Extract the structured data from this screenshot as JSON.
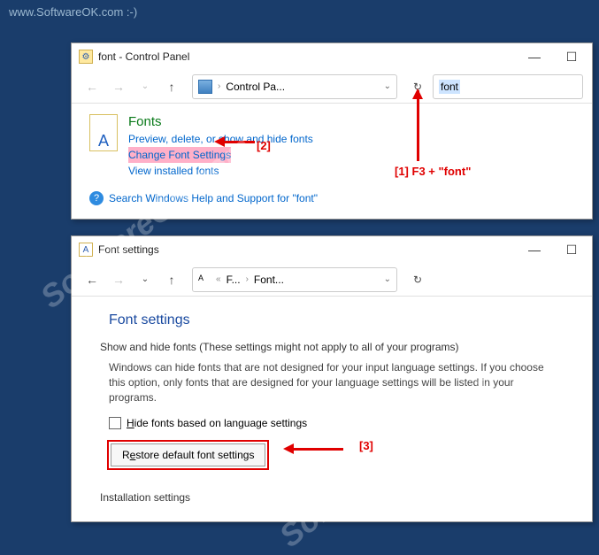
{
  "page": {
    "url_label": "www.SoftwareOK.com :-)",
    "watermark": "SoftwareOK.com"
  },
  "window1": {
    "title": "font - Control Panel",
    "address": "Control Pa...",
    "search_value": "font",
    "fonts_heading": "Fonts",
    "link_preview": "Preview, delete, or show and hide fonts",
    "link_change": "Change Font Settings",
    "link_view": "View installed fonts",
    "help_text": "Search Windows Help and Support for \"font\""
  },
  "window2": {
    "title": "Font settings",
    "breadcrumb1": "F...",
    "breadcrumb2": "Font...",
    "pane_title": "Font settings",
    "section1": "Show and hide fonts (These settings might not apply to all of your programs)",
    "desc": "Windows can hide fonts that are not designed for your input language settings. If you choose this option, only fonts that are designed for your language settings will be listed in your programs.",
    "checkbox_label": "Hide fonts based on language settings",
    "restore_btn": "Restore default font settings",
    "section2": "Installation settings"
  },
  "annotations": {
    "a1": "[1] F3 + \"font\"",
    "a2": "[2]",
    "a3": "[3]"
  }
}
